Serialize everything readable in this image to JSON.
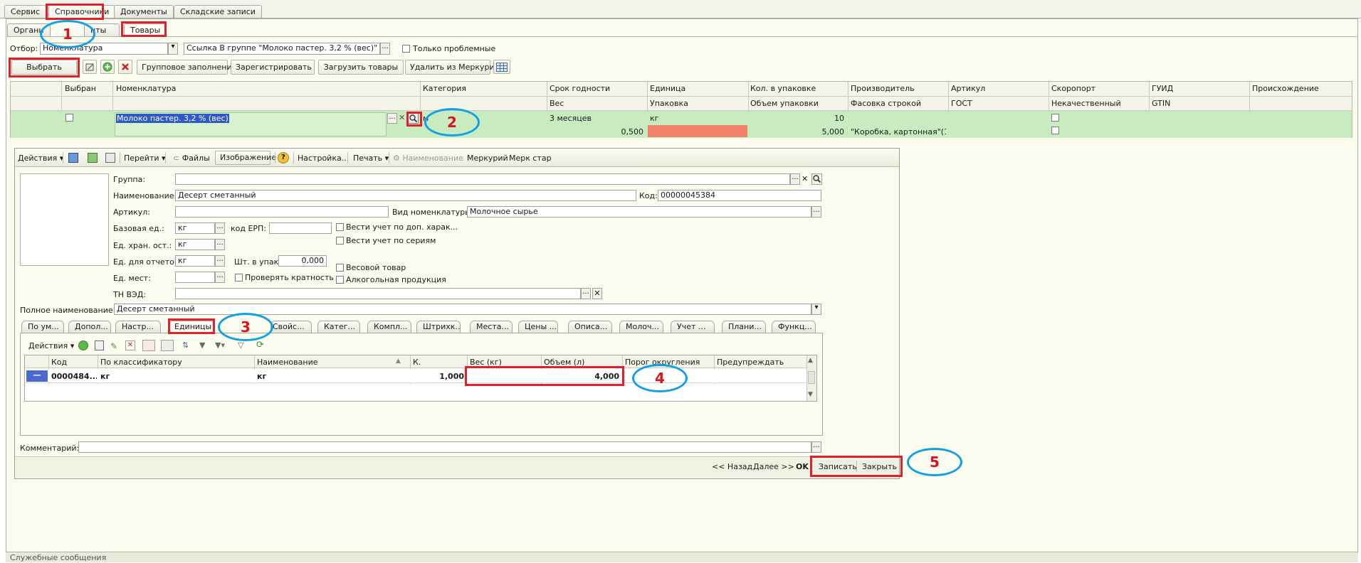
{
  "top_tabs": [
    "Сервис",
    "Справочники",
    "Документы",
    "Складские записи"
  ],
  "sub_tabs": [
    "Органи",
    "нты",
    "Товары"
  ],
  "filter": {
    "label": "Отбор:",
    "field_value": "Номенклатура",
    "ref_value": "Ссылка В группе \"Молоко пастер. 3,2 % (вес)\"",
    "only_problem_label": "Только проблемные"
  },
  "toolbar": {
    "select": "Выбрать",
    "group_fill": "Групповое заполнение",
    "register": "Зарегистрировать",
    "load": "Загрузить товары",
    "delete_mercury": "Удалить из Меркурия"
  },
  "grid": {
    "headers_top": [
      "Выбран",
      "Номенклатура",
      "Категория",
      "Срок годности",
      "Единица",
      "Кол. в упаковке",
      "Производитель",
      "Артикул",
      "Скоропорт",
      "ГУИД",
      "Происхождение"
    ],
    "headers_bottom": [
      "Вес",
      "Упаковка",
      "Объем упаковки",
      "Фасовка строкой",
      "ГОСТ",
      "Некачественный",
      "GTIN"
    ],
    "row": {
      "nomenclature": "Молоко пастер. 3,2 % (вес)",
      "category_cut": "м",
      "shelf_life": "3 месяцев",
      "unit": "кг",
      "qty_pack": "10",
      "weight": "0,500",
      "pack_volume": "5,000",
      "packing_string": "\"Коробка, картонная\"(1..."
    }
  },
  "form_toolbar": {
    "actions": "Действия",
    "goto": "Перейти",
    "files": "Файлы",
    "image": "Изображение",
    "help": "?",
    "settings": "Настройка...",
    "print": "Печать",
    "name": "Наименование",
    "mercury": "Меркурий",
    "merk_old": "Мерк стар"
  },
  "form": {
    "group_label": "Группа:",
    "name_label": "Наименование:",
    "name_value": "Десерт сметанный",
    "code_label": "Код:",
    "code_value": "00000045384",
    "article_label": "Артикул:",
    "kind_label": "Вид номенклатуры:",
    "kind_value": "Молочное сырье",
    "base_unit_label": "Базовая ед.:",
    "base_unit_value": "кг",
    "erp_label": "код ЕРП:",
    "extra_char_label": "Вести учет по доп.  харак...",
    "series_label": "Вести учет по сериям",
    "store_unit_label": "Ед. хран. ост.:",
    "store_unit_value": "кг",
    "report_unit_label": "Ед. для отчетов:",
    "report_unit_value": "кг",
    "pcs_label": "Шт. в упак.:",
    "pcs_value": "0,000",
    "weight_goods_label": "Весовой товар",
    "places_label": "Ед. мест:",
    "check_mult_label": "Проверять кратность",
    "alcohol_label": "Алкогольная продукция",
    "tnved_label": "ТН ВЭД:",
    "full_name_label": "Полное наименование:",
    "full_name_value": "Десерт сметанный",
    "comment_label": "Комментарий:"
  },
  "form_tabs": [
    "По ум...",
    "Допол...",
    "Настр...",
    "Единицы",
    "Свойс...",
    "Катег...",
    "Компл...",
    "Штрихк...",
    "Места...",
    "Цены ...",
    "Описа...",
    "Молоч...",
    "Учет ...",
    "Плани...",
    "Функц..."
  ],
  "units_toolbar": {
    "actions": "Действия"
  },
  "units_table": {
    "headers": [
      "Код",
      "По классификатору",
      "Наименование",
      "К.",
      "Вес (кг)",
      "Объем (л)",
      "Порог округления",
      "Предупреждать"
    ],
    "row": {
      "code": "0000484...",
      "classifier": "кг",
      "name": "кг",
      "k": "1,000",
      "weight": "",
      "volume": "4,000"
    }
  },
  "footer": {
    "back": "<< Назад",
    "next": "Далее >>",
    "ok": "OK",
    "write": "Записать",
    "close": "Закрыть"
  },
  "status_bar": "Служебные сообщения",
  "markers": [
    "1",
    "2",
    "3",
    "4",
    "5"
  ],
  "colors": {
    "selected_row": "#c8ecc0",
    "highlight_red": "#f4826a",
    "marker_red": "#e0202a",
    "marker_blue": "#10a0e8"
  }
}
